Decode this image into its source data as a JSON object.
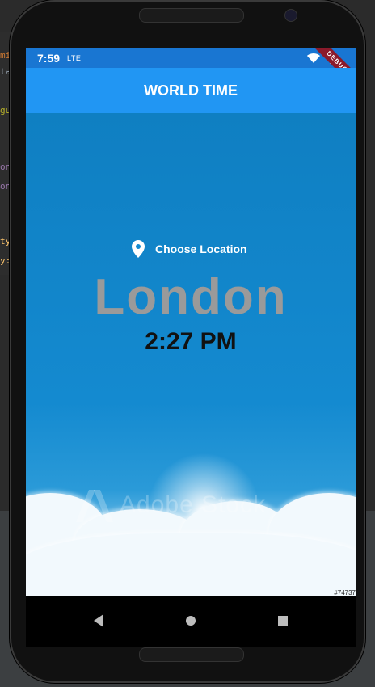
{
  "status_bar": {
    "time": "7:59",
    "network": "LTE",
    "debug_label": "DEBUG"
  },
  "app_bar": {
    "title": "WORLD TIME"
  },
  "location": {
    "choose_label": "Choose Location",
    "city": "London",
    "time": "2:27 PM"
  },
  "background_image": {
    "watermark": "Adobe Stock",
    "stock_id": "#74737"
  },
  "navigation": {
    "back_icon": "back-triangle-icon",
    "home_icon": "home-circle-icon",
    "recents_icon": "recents-square-icon"
  },
  "colors": {
    "app_bar": "#2196f3",
    "status_bar": "#1976d2",
    "city_text": "#9a9a9a",
    "time_text": "#111111"
  }
}
